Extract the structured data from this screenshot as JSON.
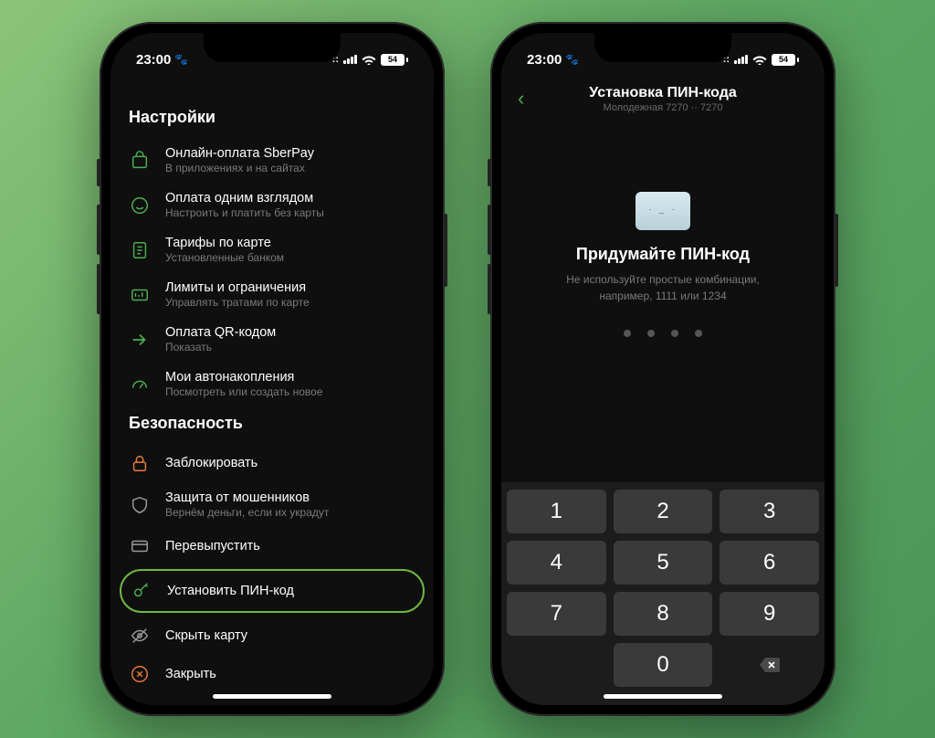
{
  "status": {
    "time": "23:00",
    "battery": "54"
  },
  "screen1": {
    "section1_title": "Настройки",
    "items1": [
      {
        "title": "Онлайн-оплата SberPay",
        "sub": "В приложениях и на сайтах"
      },
      {
        "title": "Оплата одним взглядом",
        "sub": "Настроить и платить без карты"
      },
      {
        "title": "Тарифы по карте",
        "sub": "Установленные банком"
      },
      {
        "title": "Лимиты и ограничения",
        "sub": "Управлять тратами по карте"
      },
      {
        "title": "Оплата QR-кодом",
        "sub": "Показать"
      },
      {
        "title": "Мои автонакопления",
        "sub": "Посмотреть или создать новое"
      }
    ],
    "section2_title": "Безопасность",
    "items2": [
      {
        "title": "Заблокировать",
        "sub": ""
      },
      {
        "title": "Защита от мошенников",
        "sub": "Вернём деньги, если их украдут"
      },
      {
        "title": "Перевыпустить",
        "sub": ""
      },
      {
        "title": "Установить ПИН-код",
        "sub": ""
      },
      {
        "title": "Скрыть карту",
        "sub": ""
      },
      {
        "title": "Закрыть",
        "sub": ""
      }
    ]
  },
  "screen2": {
    "nav_title": "Установка ПИН-кода",
    "nav_sub": "Молодежная 7270 ·· 7270",
    "heading": "Придумайте ПИН-код",
    "hint_l1": "Не используйте простые комбинации,",
    "hint_l2": "например, 1111 или 1234",
    "keys": [
      "1",
      "2",
      "3",
      "4",
      "5",
      "6",
      "7",
      "8",
      "9",
      "",
      "0",
      "del"
    ]
  }
}
